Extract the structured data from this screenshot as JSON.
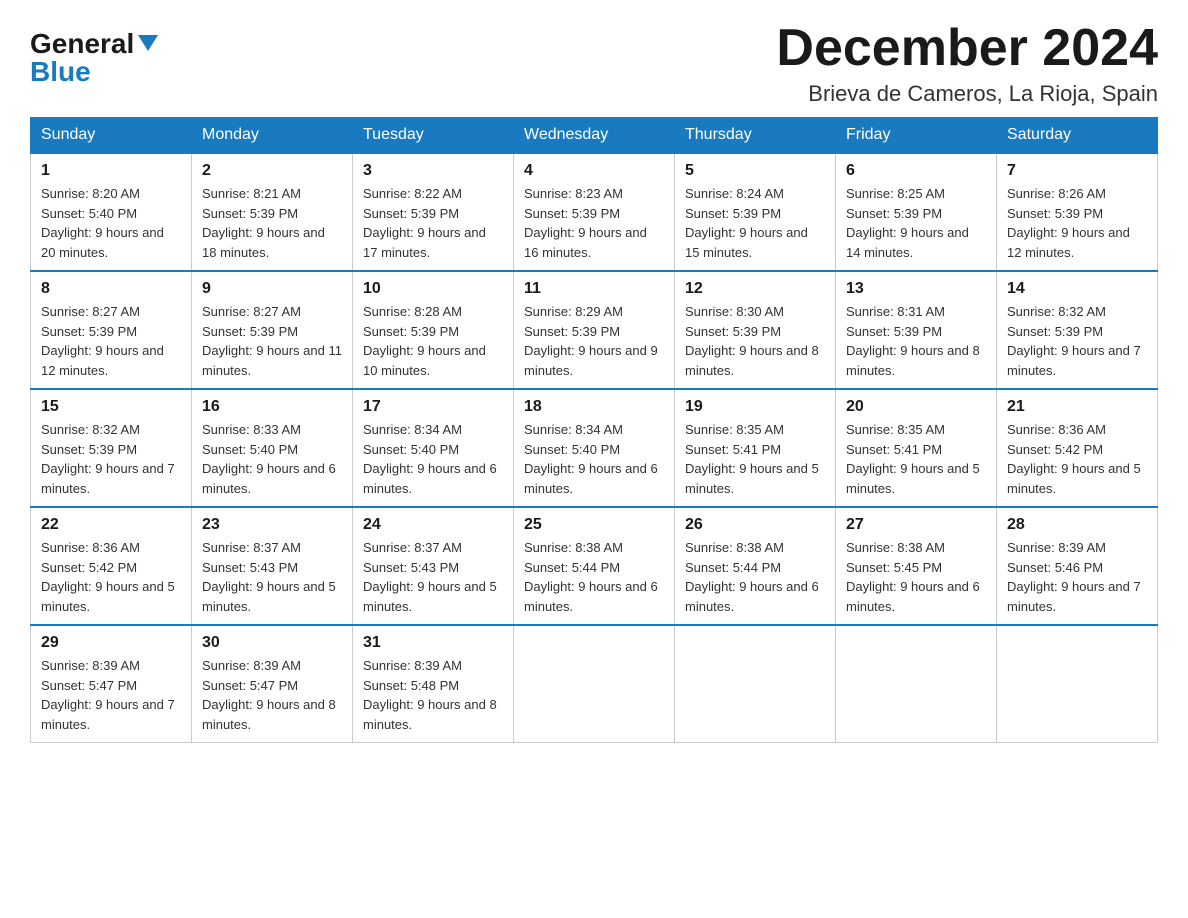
{
  "header": {
    "logo_general": "General",
    "logo_blue": "Blue",
    "month_year": "December 2024",
    "location": "Brieva de Cameros, La Rioja, Spain"
  },
  "weekdays": [
    "Sunday",
    "Monday",
    "Tuesday",
    "Wednesday",
    "Thursday",
    "Friday",
    "Saturday"
  ],
  "weeks": [
    [
      {
        "day": "1",
        "sunrise": "8:20 AM",
        "sunset": "5:40 PM",
        "daylight": "9 hours and 20 minutes."
      },
      {
        "day": "2",
        "sunrise": "8:21 AM",
        "sunset": "5:39 PM",
        "daylight": "9 hours and 18 minutes."
      },
      {
        "day": "3",
        "sunrise": "8:22 AM",
        "sunset": "5:39 PM",
        "daylight": "9 hours and 17 minutes."
      },
      {
        "day": "4",
        "sunrise": "8:23 AM",
        "sunset": "5:39 PM",
        "daylight": "9 hours and 16 minutes."
      },
      {
        "day": "5",
        "sunrise": "8:24 AM",
        "sunset": "5:39 PM",
        "daylight": "9 hours and 15 minutes."
      },
      {
        "day": "6",
        "sunrise": "8:25 AM",
        "sunset": "5:39 PM",
        "daylight": "9 hours and 14 minutes."
      },
      {
        "day": "7",
        "sunrise": "8:26 AM",
        "sunset": "5:39 PM",
        "daylight": "9 hours and 12 minutes."
      }
    ],
    [
      {
        "day": "8",
        "sunrise": "8:27 AM",
        "sunset": "5:39 PM",
        "daylight": "9 hours and 12 minutes."
      },
      {
        "day": "9",
        "sunrise": "8:27 AM",
        "sunset": "5:39 PM",
        "daylight": "9 hours and 11 minutes."
      },
      {
        "day": "10",
        "sunrise": "8:28 AM",
        "sunset": "5:39 PM",
        "daylight": "9 hours and 10 minutes."
      },
      {
        "day": "11",
        "sunrise": "8:29 AM",
        "sunset": "5:39 PM",
        "daylight": "9 hours and 9 minutes."
      },
      {
        "day": "12",
        "sunrise": "8:30 AM",
        "sunset": "5:39 PM",
        "daylight": "9 hours and 8 minutes."
      },
      {
        "day": "13",
        "sunrise": "8:31 AM",
        "sunset": "5:39 PM",
        "daylight": "9 hours and 8 minutes."
      },
      {
        "day": "14",
        "sunrise": "8:32 AM",
        "sunset": "5:39 PM",
        "daylight": "9 hours and 7 minutes."
      }
    ],
    [
      {
        "day": "15",
        "sunrise": "8:32 AM",
        "sunset": "5:39 PM",
        "daylight": "9 hours and 7 minutes."
      },
      {
        "day": "16",
        "sunrise": "8:33 AM",
        "sunset": "5:40 PM",
        "daylight": "9 hours and 6 minutes."
      },
      {
        "day": "17",
        "sunrise": "8:34 AM",
        "sunset": "5:40 PM",
        "daylight": "9 hours and 6 minutes."
      },
      {
        "day": "18",
        "sunrise": "8:34 AM",
        "sunset": "5:40 PM",
        "daylight": "9 hours and 6 minutes."
      },
      {
        "day": "19",
        "sunrise": "8:35 AM",
        "sunset": "5:41 PM",
        "daylight": "9 hours and 5 minutes."
      },
      {
        "day": "20",
        "sunrise": "8:35 AM",
        "sunset": "5:41 PM",
        "daylight": "9 hours and 5 minutes."
      },
      {
        "day": "21",
        "sunrise": "8:36 AM",
        "sunset": "5:42 PM",
        "daylight": "9 hours and 5 minutes."
      }
    ],
    [
      {
        "day": "22",
        "sunrise": "8:36 AM",
        "sunset": "5:42 PM",
        "daylight": "9 hours and 5 minutes."
      },
      {
        "day": "23",
        "sunrise": "8:37 AM",
        "sunset": "5:43 PM",
        "daylight": "9 hours and 5 minutes."
      },
      {
        "day": "24",
        "sunrise": "8:37 AM",
        "sunset": "5:43 PM",
        "daylight": "9 hours and 5 minutes."
      },
      {
        "day": "25",
        "sunrise": "8:38 AM",
        "sunset": "5:44 PM",
        "daylight": "9 hours and 6 minutes."
      },
      {
        "day": "26",
        "sunrise": "8:38 AM",
        "sunset": "5:44 PM",
        "daylight": "9 hours and 6 minutes."
      },
      {
        "day": "27",
        "sunrise": "8:38 AM",
        "sunset": "5:45 PM",
        "daylight": "9 hours and 6 minutes."
      },
      {
        "day": "28",
        "sunrise": "8:39 AM",
        "sunset": "5:46 PM",
        "daylight": "9 hours and 7 minutes."
      }
    ],
    [
      {
        "day": "29",
        "sunrise": "8:39 AM",
        "sunset": "5:47 PM",
        "daylight": "9 hours and 7 minutes."
      },
      {
        "day": "30",
        "sunrise": "8:39 AM",
        "sunset": "5:47 PM",
        "daylight": "9 hours and 8 minutes."
      },
      {
        "day": "31",
        "sunrise": "8:39 AM",
        "sunset": "5:48 PM",
        "daylight": "9 hours and 8 minutes."
      },
      null,
      null,
      null,
      null
    ]
  ]
}
